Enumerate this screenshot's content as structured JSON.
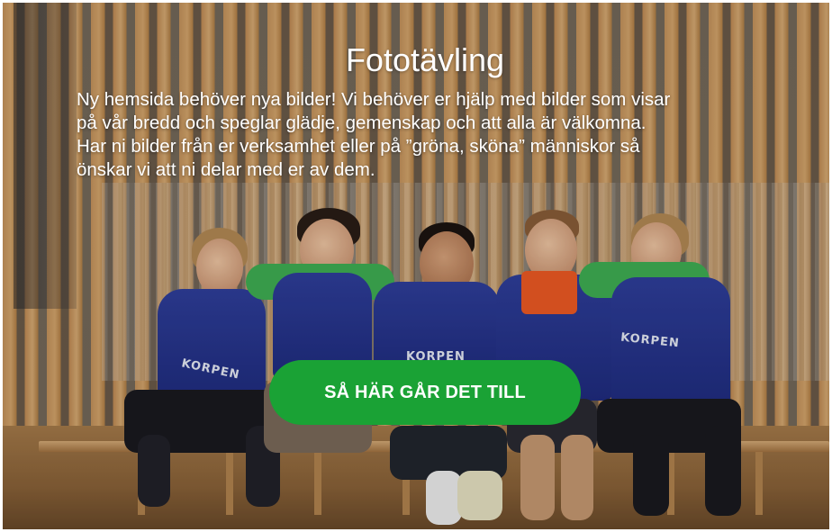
{
  "banner": {
    "title": "Fototävling",
    "body_lines": [
      "Ny hemsida behöver nya bilder! Vi behöver er hjälp med bilder som visar",
      "på vår bredd och speglar glädje, gemenskap och att alla är välkomna.",
      "Har ni bilder från er verksamhet eller på ”gröna, sköna” människor så",
      "önskar vi att ni delar med er av dem."
    ],
    "cta_label": "SÅ HÄR GÅR DET TILL",
    "vest_label": "KORPEN"
  },
  "colors": {
    "cta_background": "#1aa235",
    "text": "#ffffff",
    "vest": "#2f3f9c"
  },
  "image": {
    "alt_icon": "group-photo-five-people-on-bench"
  }
}
